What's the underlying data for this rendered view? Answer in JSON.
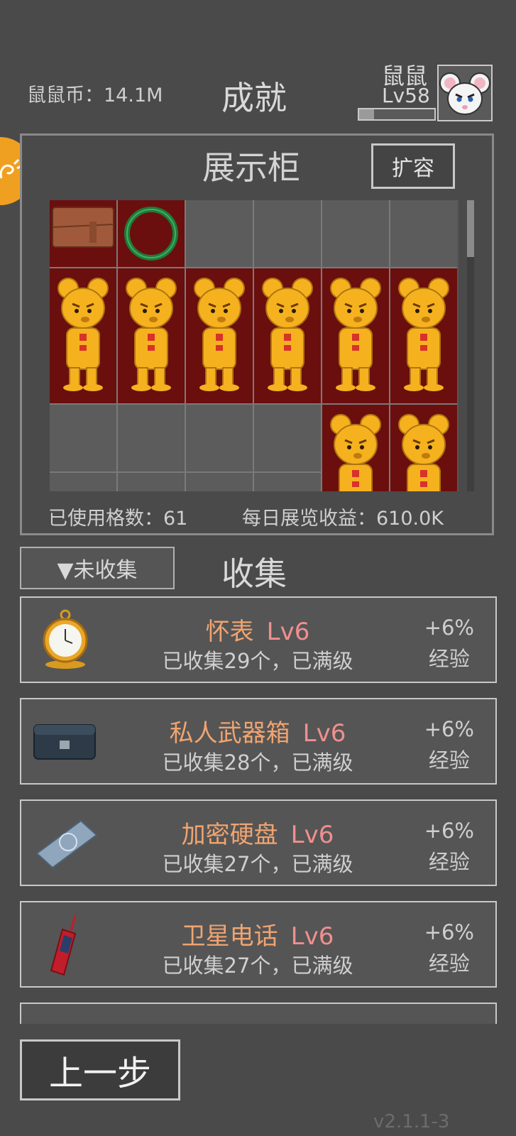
{
  "header": {
    "coins_label": "鼠鼠币：14.1M",
    "title": "成就",
    "player_name": "鼠鼠",
    "player_level": "Lv58",
    "xp_fraction": 0.2
  },
  "cabinet": {
    "title": "展示柜",
    "expand_label": "扩容",
    "used_slots_label": "已使用格数：61",
    "daily_income_label": "每日展览收益：610.0K",
    "colors": {
      "filled": "#6b0e0e",
      "empty": "#5c5c5c",
      "bear_gold": "#f5b21e"
    }
  },
  "collection": {
    "filter_label": "▼未收集",
    "title": "收集",
    "items": [
      {
        "name": "怀表",
        "level": "Lv6",
        "status": "已收集29个，已满级",
        "bonus_pct": "+6%",
        "bonus_type": "经验",
        "icon": "pocket-watch-icon"
      },
      {
        "name": "私人武器箱",
        "level": "Lv6",
        "status": "已收集28个，已满级",
        "bonus_pct": "+6%",
        "bonus_type": "经验",
        "icon": "weapon-case-icon"
      },
      {
        "name": "加密硬盘",
        "level": "Lv6",
        "status": "已收集27个，已满级",
        "bonus_pct": "+6%",
        "bonus_type": "经验",
        "icon": "hard-drive-icon"
      },
      {
        "name": "卫星电话",
        "level": "Lv6",
        "status": "已收集27个，已满级",
        "bonus_pct": "+6%",
        "bonus_type": "经验",
        "icon": "satellite-phone-icon"
      }
    ]
  },
  "footer": {
    "back_label": "上一步",
    "version": "v2.1.1-3"
  }
}
